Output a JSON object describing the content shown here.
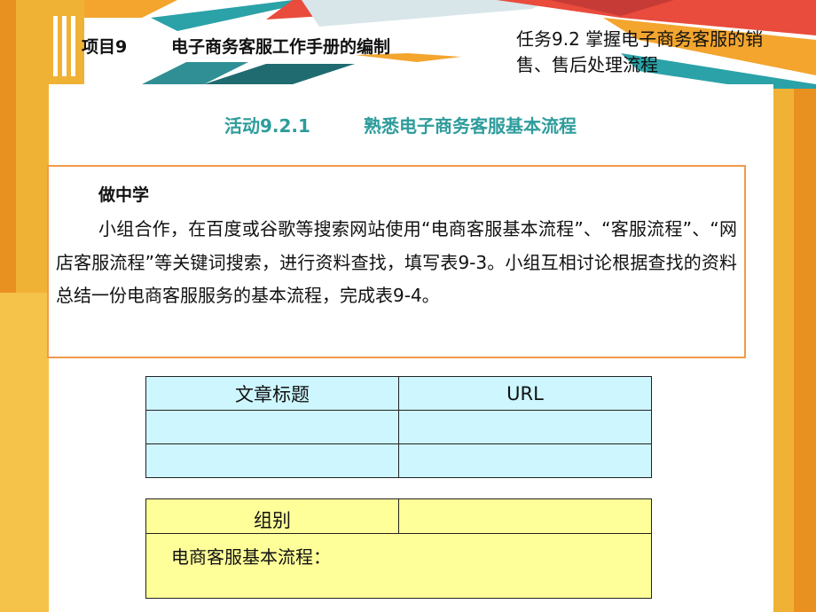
{
  "header": {
    "project_label": "项目9",
    "project_title": "电子商务客服工作手册的编制",
    "task_title": "任务9.2  掌握电子商务客服的销售、售后处理流程"
  },
  "activity": {
    "number": "活动9.2.1",
    "name": "熟悉电子商务客服基本流程"
  },
  "content": {
    "heading": "做中学",
    "text": "小组合作，在百度或谷歌等搜索网站使用“电商客服基本流程”、“客服流程”、“网店客服流程”等关键词搜索，进行资料查找，填写表9-3。小组互相讨论根据查找的资料总结一份电商客服服务的基本流程，完成表9-4。"
  },
  "table_urls": {
    "headers": [
      "文章标题",
      "URL"
    ],
    "rows": [
      [
        "",
        ""
      ],
      [
        "",
        ""
      ]
    ]
  },
  "table_group": {
    "group_label": "组别",
    "group_value": "",
    "flow_label": "电商客服基本流程："
  },
  "colors": {
    "accent_teal": "#2e9c9c",
    "box_border": "#f29a4a",
    "table1_fill": "#cdf6ff",
    "table2_fill": "#ffff99"
  }
}
